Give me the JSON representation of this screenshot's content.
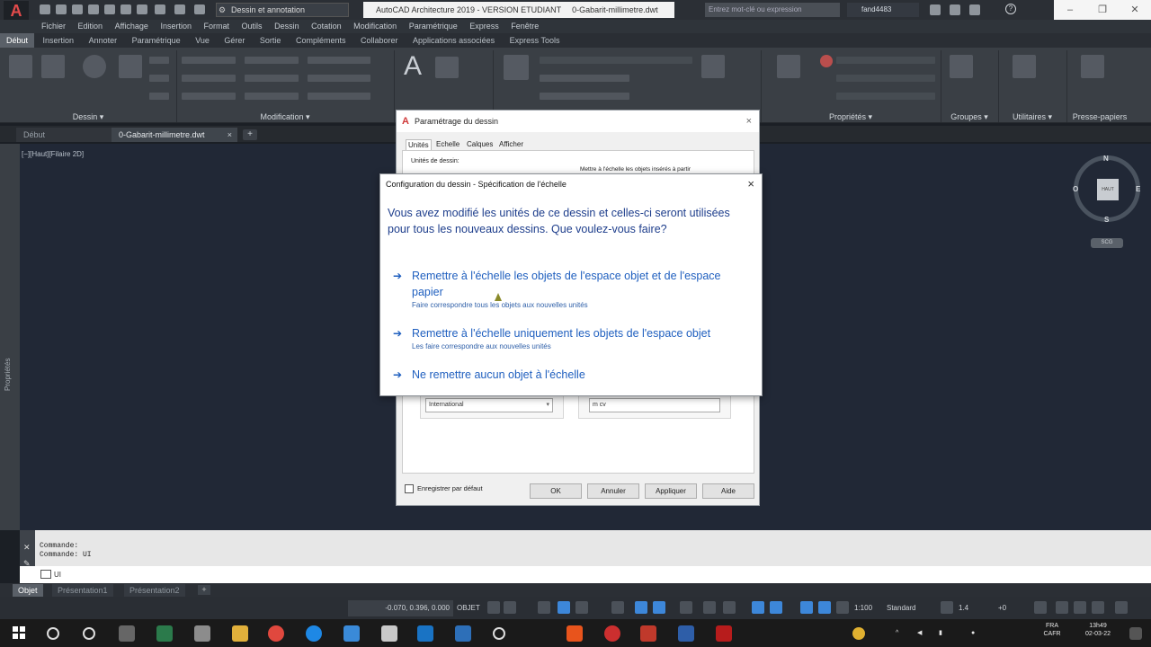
{
  "titlebar": {
    "workspace": "Dessin et annotation",
    "app_title": "AutoCAD Architecture 2019 - VERSION ETUDIANT",
    "file_name": "0-Gabarit-millimetre.dwt",
    "search_placeholder": "Entrez mot-clé ou expression",
    "user": "fand4483"
  },
  "menu": [
    "Fichier",
    "Edition",
    "Affichage",
    "Insertion",
    "Format",
    "Outils",
    "Dessin",
    "Cotation",
    "Modification",
    "Paramétrique",
    "Express",
    "Fenêtre"
  ],
  "ribbon_tabs": [
    "Début",
    "Insertion",
    "Annoter",
    "Paramétrique",
    "Vue",
    "Gérer",
    "Sortie",
    "Compléments",
    "Collaborer",
    "Applications associées",
    "Express Tools"
  ],
  "ribbon_panels": [
    "Dessin",
    "Modification",
    "Propriétés",
    "Groupes",
    "Utilitaires",
    "Presse-papiers"
  ],
  "doc_tabs": {
    "start": "Début",
    "active": "0-Gabarit-millimetre.dwt"
  },
  "viewport_label": "[−][Haut][Filaire 2D]",
  "side_palette": "Propriétés",
  "viewcube": {
    "n": "N",
    "s": "S",
    "e": "E",
    "w": "O",
    "face": "HAUT",
    "wcs": "SCG"
  },
  "bg_dialog": {
    "title": "Paramétrage du dessin",
    "tabs": [
      "Unités",
      "Echelle",
      "Calques",
      "Afficher"
    ],
    "units_label": "Unités de dessin:",
    "scale_check": "Mettre à l'échelle les objets insérés à partir",
    "standard_value": "International",
    "field_value": "m cv",
    "save_default": "Enregistrer par défaut",
    "buttons": {
      "ok": "OK",
      "cancel": "Annuler",
      "apply": "Appliquer",
      "help": "Aide"
    }
  },
  "dialog": {
    "title": "Configuration du dessin - Spécification de l'échelle",
    "question": "Vous avez modifié les unités de ce dessin et celles-ci seront utilisées pour tous les nouveaux dessins. Que voulez-vous faire?",
    "options": [
      {
        "label": "Remettre à l'échelle les objets de l'espace objet et de l'espace papier",
        "desc": "Faire correspondre tous les objets aux nouvelles unités"
      },
      {
        "label": "Remettre à l'échelle uniquement les objets de l'espace objet",
        "desc": "Les faire correspondre aux nouvelles unités"
      },
      {
        "label": "Ne remettre aucun objet à l'échelle",
        "desc": ""
      }
    ]
  },
  "command": {
    "history1": "Commande:",
    "history2": "Commande: UI",
    "input": "UI"
  },
  "layout_tabs": [
    "Objet",
    "Présentation1",
    "Présentation2"
  ],
  "status": {
    "coords": "-0.070, 0.396, 0.000",
    "mode": "OBJET",
    "scale": "1:100",
    "style": "Standard",
    "value": "1.4",
    "extra": "+0"
  },
  "taskbar": {
    "lang1": "FRA",
    "lang2": "CAFR",
    "time": "13h49",
    "date": "02-03-22"
  }
}
